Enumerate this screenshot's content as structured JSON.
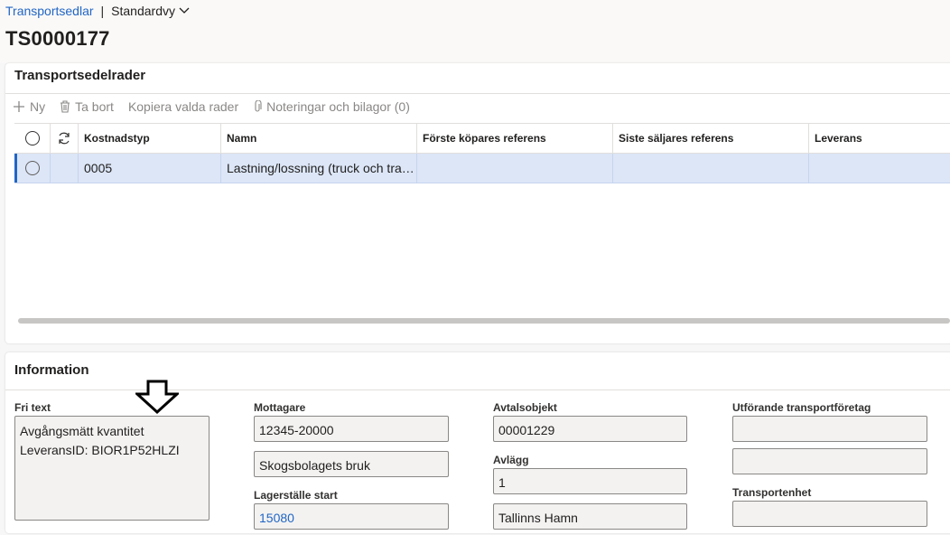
{
  "breadcrumb": {
    "link": "Transportsedlar",
    "separator": "|",
    "view": "Standardvy"
  },
  "page_title": "TS0000177",
  "lines_section": {
    "title": "Transportsedelrader",
    "toolbar": {
      "new": "Ny",
      "delete": "Ta bort",
      "copy": "Kopiera valda rader",
      "notes": "Noteringar och bilagor (0)"
    },
    "columns": [
      "Kostnadstyp",
      "Namn",
      "Förste köpares referens",
      "Siste säljares referens",
      "Leverans"
    ],
    "rows": [
      {
        "kostnadstyp": "0005",
        "namn": "Lastning/lossning (truck och tra…",
        "forste": "",
        "siste": "",
        "leverans": ""
      }
    ]
  },
  "info_section": {
    "title": "Information",
    "fri_text": {
      "label": "Fri text",
      "value": "Avgångsmätt kvantitet\nLeveransID: BIOR1P52HLZI"
    },
    "mottagare": {
      "label": "Mottagare",
      "value1": "12345-20000",
      "value2": "Skogsbolagets bruk"
    },
    "lagerstalle_start": {
      "label": "Lagerställe start",
      "value": "15080"
    },
    "avtalsobjekt": {
      "label": "Avtalsobjekt",
      "value": "00001229"
    },
    "avlagg": {
      "label": "Avlägg",
      "value1": "1",
      "value2": "Tallinns Hamn"
    },
    "transportforetag": {
      "label": "Utförande transportföretag",
      "value1": "",
      "value2": ""
    },
    "transportenhet": {
      "label": "Transportenhet",
      "value": ""
    }
  }
}
